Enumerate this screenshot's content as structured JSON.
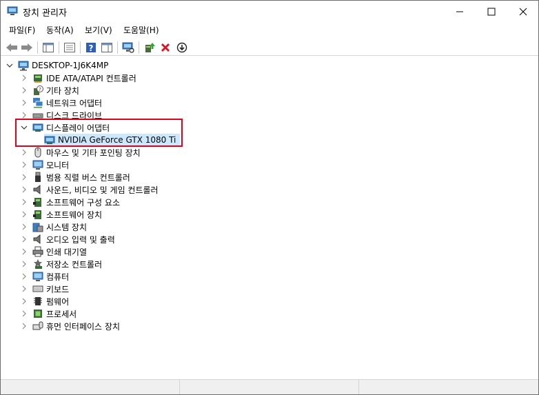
{
  "window": {
    "title": "장치 관리자",
    "controls": {
      "minimize": "—",
      "maximize": "☐",
      "close": "✕"
    }
  },
  "menu": [
    "파일(F)",
    "동작(A)",
    "보기(V)",
    "도움말(H)"
  ],
  "toolbar": [
    {
      "name": "back-icon"
    },
    {
      "name": "forward-icon"
    },
    {
      "name": "show-hide-console-tree-icon"
    },
    {
      "name": "properties-icon"
    },
    {
      "name": "help-icon"
    },
    {
      "name": "action-pane-icon"
    },
    {
      "name": "scan-hardware-icon"
    },
    {
      "name": "update-driver-icon"
    },
    {
      "name": "uninstall-device-icon"
    },
    {
      "name": "download-icon"
    }
  ],
  "tree": {
    "root": "DESKTOP-1J6K4MP",
    "categories": [
      "IDE ATA/ATAPI 컨트롤러",
      "기타 장치",
      "네트워크 어댑터",
      "디스크 드라이브",
      "디스플레이 어댑터",
      "마우스 및 기타 포인팅 장치",
      "모니터",
      "범용 직렬 버스 컨트롤러",
      "사운드, 비디오 및 게임 컨트롤러",
      "소프트웨어 구성 요소",
      "소프트웨어 장치",
      "시스템 장치",
      "오디오 입력 및 출력",
      "인쇄 대기열",
      "저장소 컨트롤러",
      "컴퓨터",
      "키보드",
      "펌웨어",
      "프로세서",
      "휴먼 인터페이스 장치"
    ],
    "display_child": "NVIDIA GeForce GTX 1080 Ti"
  },
  "colors": {
    "highlight_border": "#e0001a",
    "selection_bg": "#cce8ff"
  }
}
